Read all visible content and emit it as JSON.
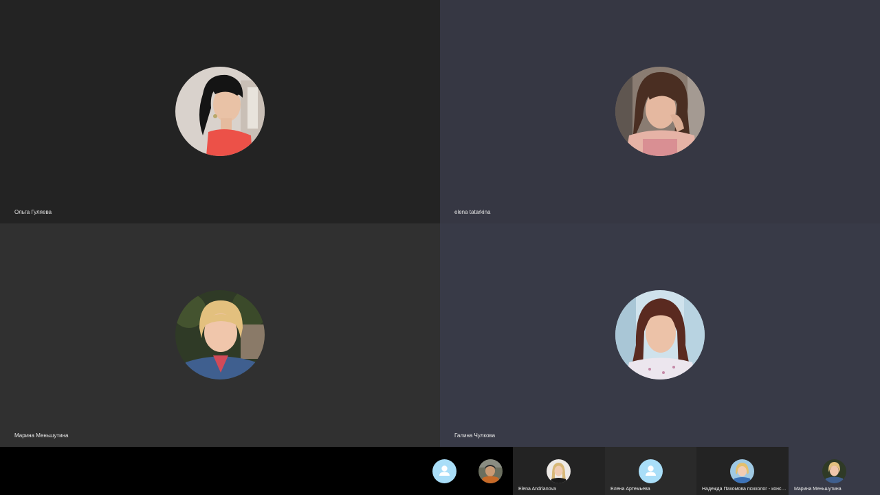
{
  "participants": [
    {
      "name": "Ольга Гуляева",
      "background": "#232323",
      "avatar": "woman-black-hair-red-top"
    },
    {
      "name": "elena tatarkina",
      "background": "#363743",
      "avatar": "woman-brown-hair-pink-top"
    },
    {
      "name": "Марина Меньшутина",
      "background": "#303030",
      "avatar": "woman-blonde-denim-jacket"
    },
    {
      "name": "Галина Чулкова",
      "background": "#383a47",
      "avatar": "woman-auburn-hair-light-blouse"
    }
  ],
  "thumbnails": [
    {
      "name": "",
      "avatar": "default-user-icon",
      "background": "#000000"
    },
    {
      "name": "",
      "avatar": "person-photo",
      "background": "#000000"
    },
    {
      "name": "Elena Andrianova",
      "avatar": "woman-blonde-photo",
      "background": "#232323"
    },
    {
      "name": "Елена Артемьева",
      "avatar": "default-user-icon",
      "background": "#2a2a2a"
    },
    {
      "name": "Надежда Пахомова психолог - консультант",
      "avatar": "woman-blonde-blue-photo",
      "background": "#232323"
    },
    {
      "name": "Марина Меньшутина",
      "avatar": "woman-blonde-denim-photo",
      "background": "#383a47"
    }
  ],
  "colors": {
    "default_avatar": "#a9def8",
    "name_text": "#e8e8e8"
  }
}
